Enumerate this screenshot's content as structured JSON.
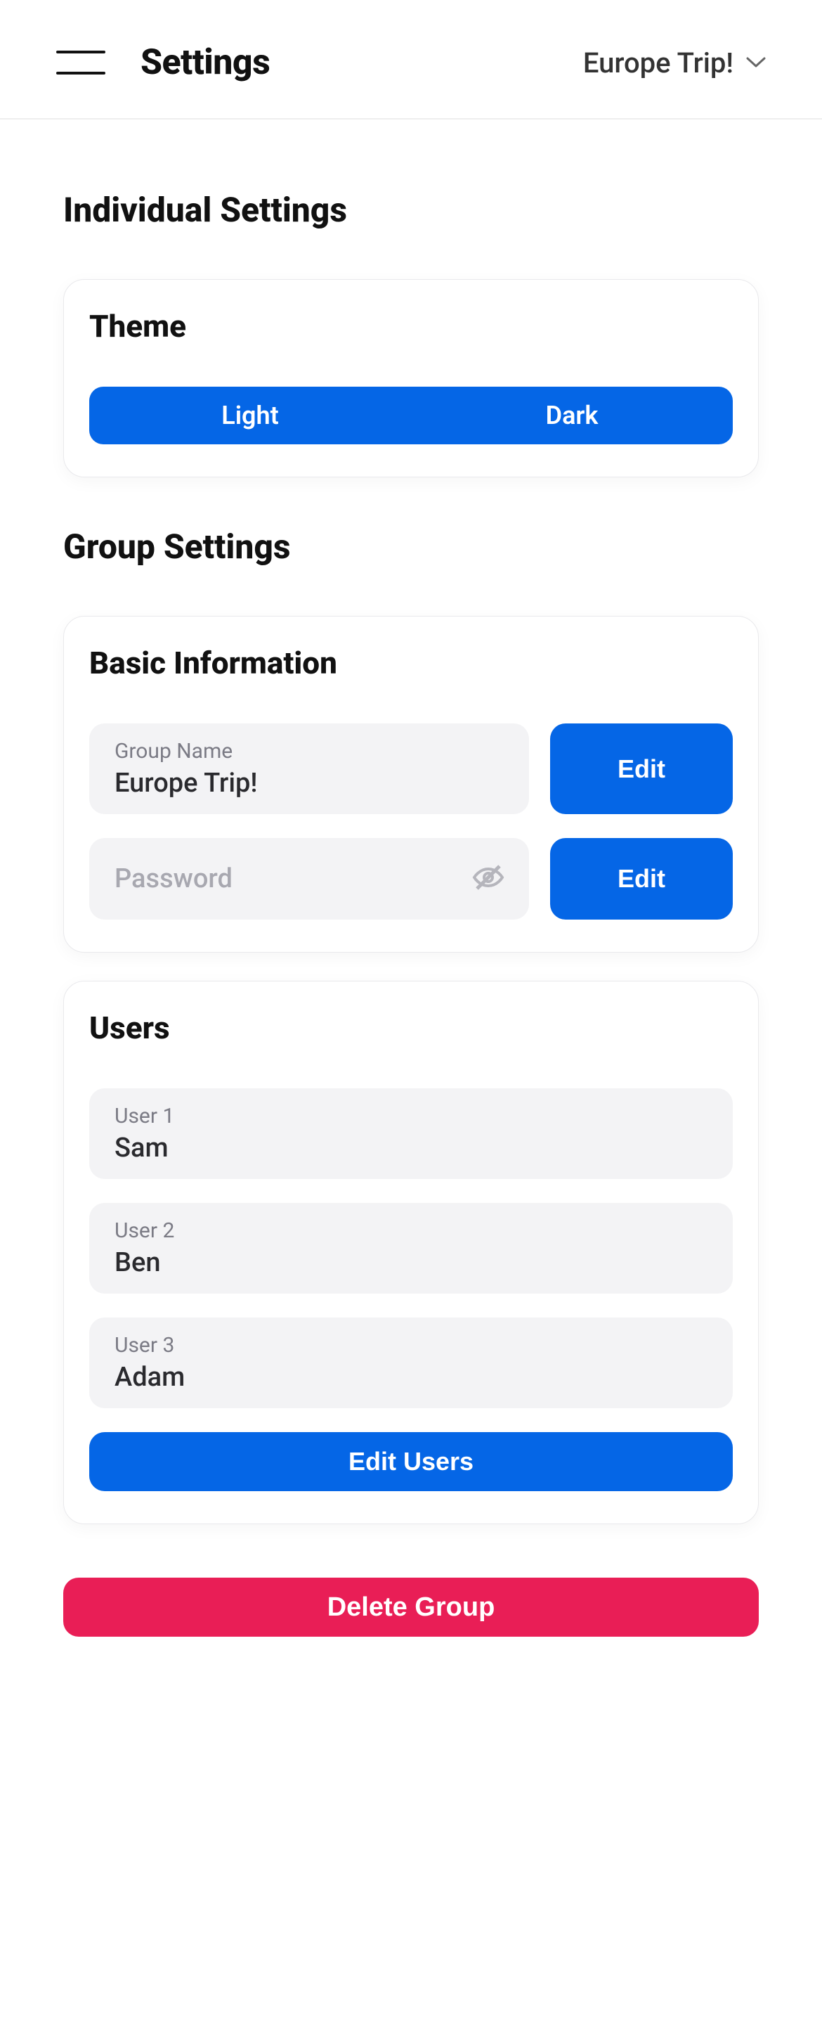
{
  "header": {
    "title": "Settings",
    "group_selected": "Europe Trip!"
  },
  "sections": {
    "individual_heading": "Individual Settings",
    "group_heading": "Group Settings"
  },
  "theme": {
    "card_title": "Theme",
    "options": {
      "light": "Light",
      "dark": "Dark"
    }
  },
  "basic_info": {
    "card_title": "Basic Information",
    "group_name_label": "Group Name",
    "group_name_value": "Europe Trip!",
    "group_name_edit": "Edit",
    "password_placeholder": "Password",
    "password_edit": "Edit"
  },
  "users": {
    "card_title": "Users",
    "items": [
      {
        "label": "User 1",
        "name": "Sam"
      },
      {
        "label": "User 2",
        "name": "Ben"
      },
      {
        "label": "User 3",
        "name": "Adam"
      }
    ],
    "edit_button": "Edit Users"
  },
  "actions": {
    "delete_group": "Delete Group"
  },
  "colors": {
    "primary": "#0566E6",
    "danger": "#E91E56"
  }
}
